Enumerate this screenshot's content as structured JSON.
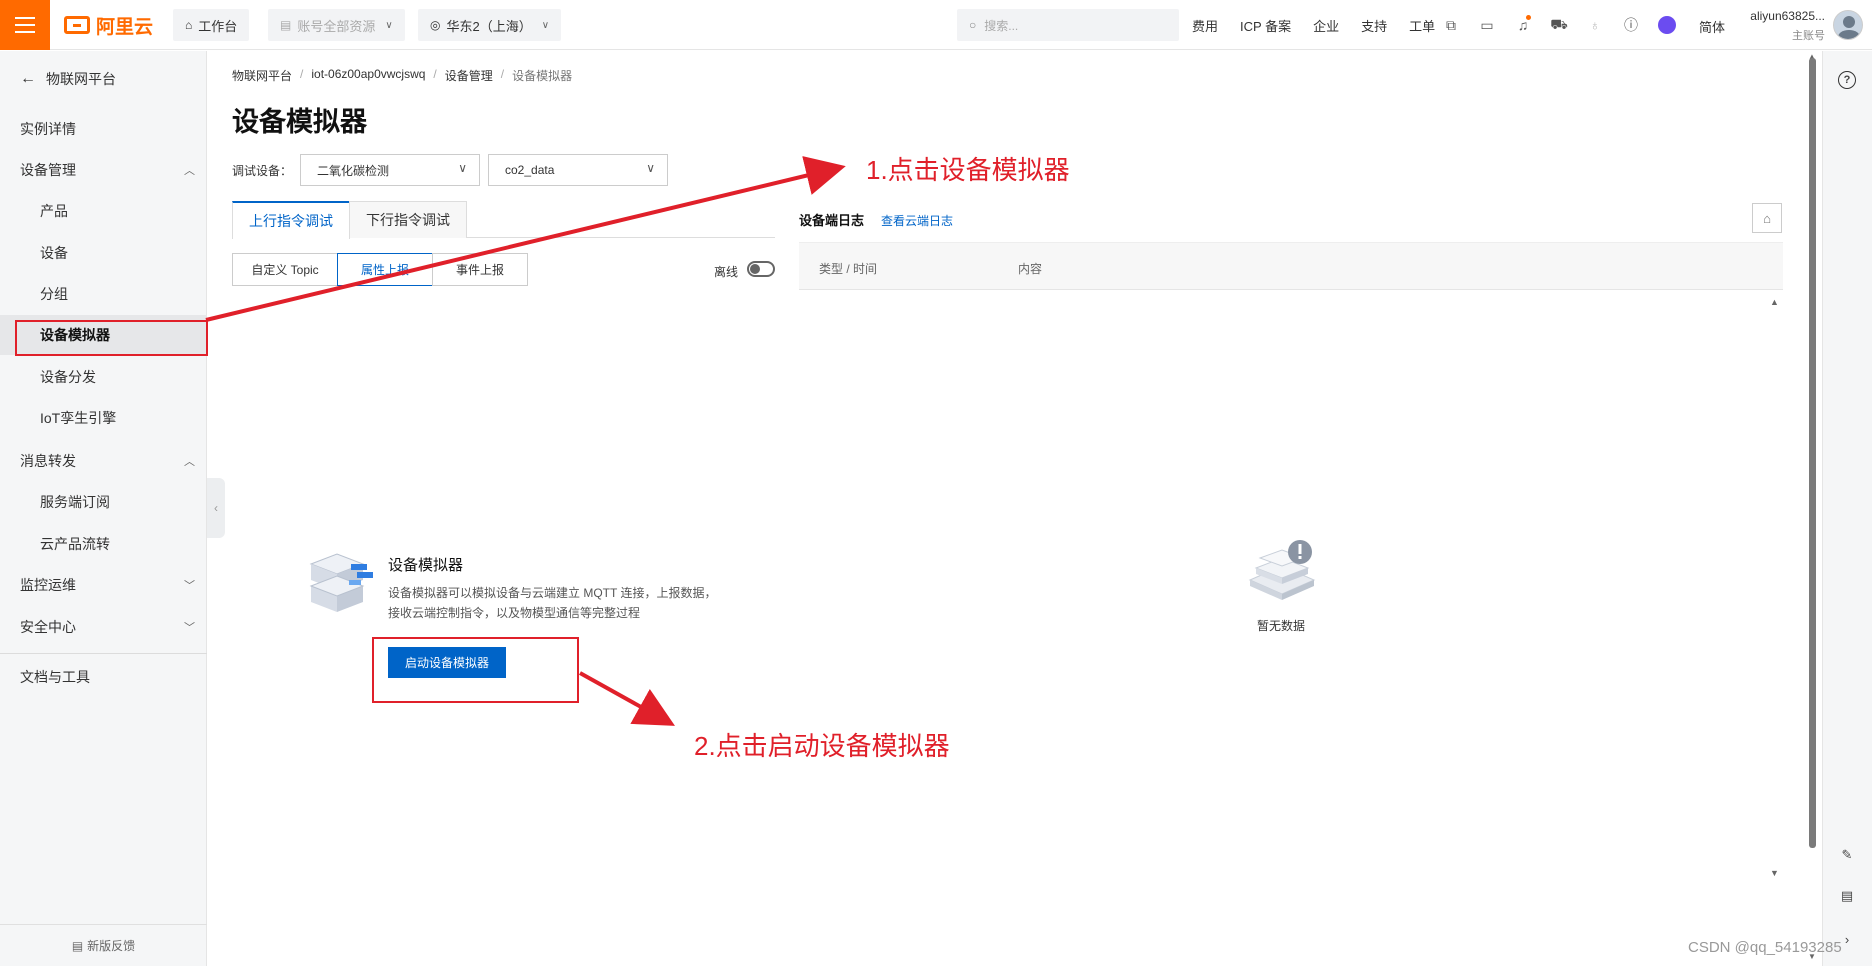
{
  "topbar": {
    "brand": "阿里云",
    "workbench": "工作台",
    "resources": "账号全部资源",
    "region": "华东2（上海）",
    "search_placeholder": "搜索...",
    "links": [
      "费用",
      "ICP 备案",
      "企业",
      "支持",
      "工单"
    ],
    "language": "简体",
    "user_name": "aliyun63825...",
    "user_role": "主账号",
    "brand_color": "#ff6a00"
  },
  "sidebar": {
    "back": "物联网平台",
    "items": [
      {
        "label": "实例详情",
        "level": 1
      },
      {
        "label": "设备管理",
        "level": 1,
        "caret": "up"
      },
      {
        "label": "产品",
        "level": 2
      },
      {
        "label": "设备",
        "level": 2
      },
      {
        "label": "分组",
        "level": 2
      },
      {
        "label": "设备模拟器",
        "level": 2,
        "active": true
      },
      {
        "label": "设备分发",
        "level": 2
      },
      {
        "label": "IoT孪生引擎",
        "level": 2
      },
      {
        "label": "消息转发",
        "level": 1,
        "caret": "up"
      },
      {
        "label": "服务端订阅",
        "level": 2
      },
      {
        "label": "云产品流转",
        "level": 2
      },
      {
        "label": "监控运维",
        "level": 1,
        "caret": "down"
      },
      {
        "label": "安全中心",
        "level": 1,
        "caret": "down"
      },
      {
        "label": "文档与工具",
        "level": 1
      }
    ],
    "feedback": "新版反馈"
  },
  "breadcrumb": [
    "物联网平台",
    "iot-06z00ap0vwcjswq",
    "设备管理",
    "设备模拟器"
  ],
  "page_title": "设备模拟器",
  "debug": {
    "label": "调试设备：",
    "product": "二氧化碳检测",
    "device": "co2_data"
  },
  "tabs": [
    "上行指令调试",
    "下行指令调试"
  ],
  "segments": [
    "自定义 Topic",
    "属性上报",
    "事件上报"
  ],
  "offline_label": "离线",
  "simulator": {
    "title": "设备模拟器",
    "description": "设备模拟器可以模拟设备与云端建立 MQTT 连接，上报数据，接收云端控制指令，以及物模型通信等完整过程",
    "start_button": "启动设备模拟器"
  },
  "log": {
    "title": "设备端日志",
    "link": "查看云端日志",
    "col_type": "类型 / 时间",
    "col_content": "内容",
    "empty": "暂无数据"
  },
  "annotations": {
    "step1": "1.点击设备模拟器",
    "step2": "2.点击启动设备模拟器",
    "color": "#e0202a"
  },
  "watermark": "CSDN @qq_54193285"
}
